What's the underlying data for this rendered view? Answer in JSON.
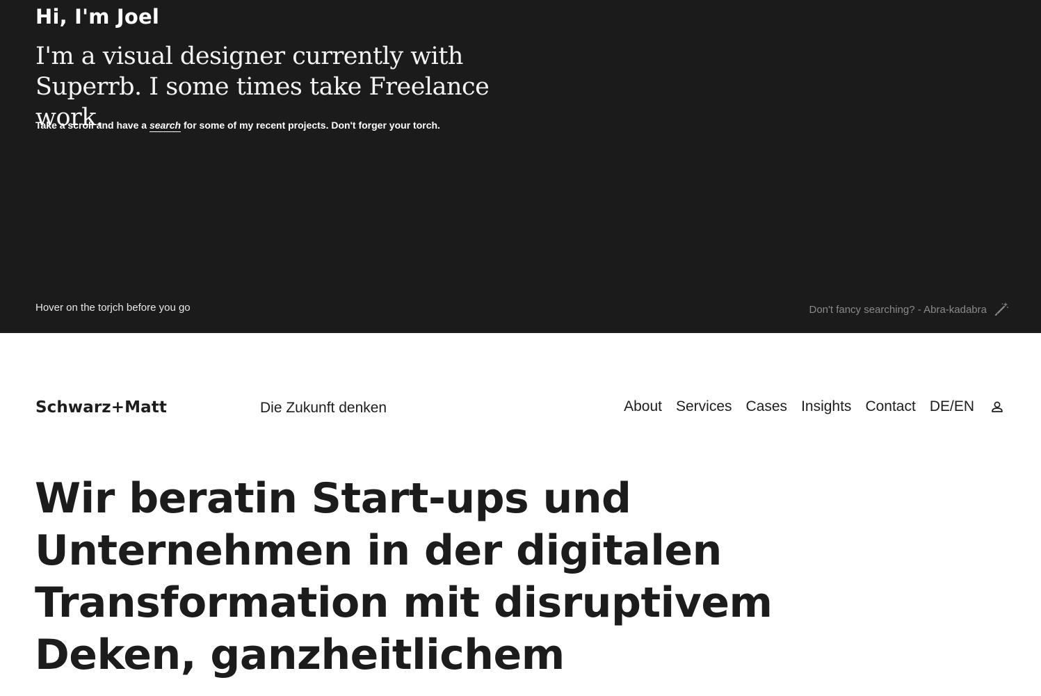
{
  "hero": {
    "greeting": "Hi, I'm Joel",
    "intro": "I'm a visual designer currently with Superrb. I some times take Freelance work.",
    "scroll_before": "Take a scroll and have a ",
    "scroll_link": "search",
    "scroll_after": " for some of my recent projects. Don't forger your torch.",
    "hover_note": "Hover on the torjch before you go",
    "magic_text": "Don't fancy searching? - Abra-kadabra",
    "magic_icon": "magic-wand-icon",
    "background_color": "#1b1b1b"
  },
  "header": {
    "logo": "Schwarz+Matt",
    "tagline": "Die Zukunft denken",
    "nav": [
      {
        "label": "About"
      },
      {
        "label": "Services"
      },
      {
        "label": "Cases"
      },
      {
        "label": "Insights"
      },
      {
        "label": "Contact"
      },
      {
        "label": "DE/EN"
      }
    ],
    "account_icon": "user-icon"
  },
  "main": {
    "headline": "Wir beratin Start-ups und Unternehmen in der digitalen Transformation mit disruptivem Deken, ganzheitlichem"
  }
}
